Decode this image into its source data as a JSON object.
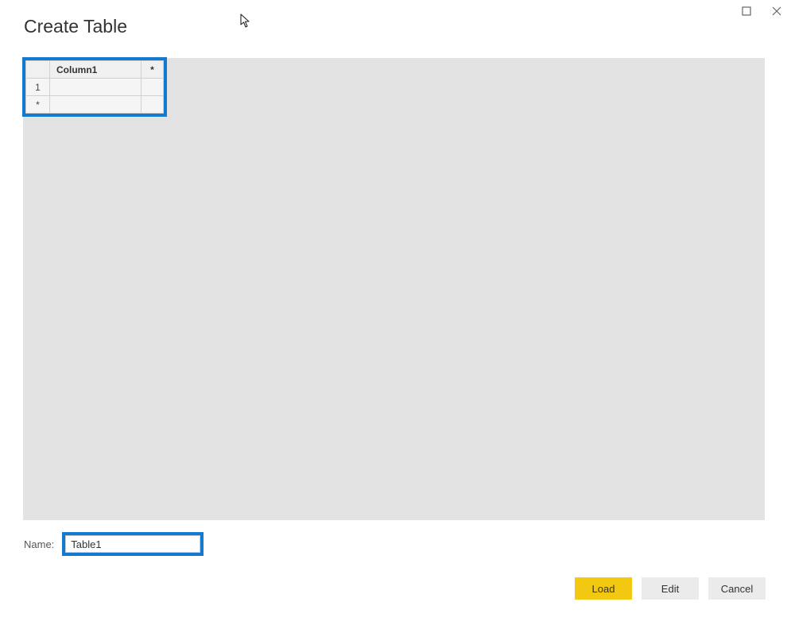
{
  "dialog": {
    "title": "Create Table"
  },
  "table": {
    "columnHeader": "Column1",
    "addColumnMarker": "*",
    "rows": [
      {
        "num": "1",
        "value": ""
      },
      {
        "num": "*",
        "value": ""
      }
    ]
  },
  "nameField": {
    "label": "Name:",
    "value": "Table1"
  },
  "buttons": {
    "load": "Load",
    "edit": "Edit",
    "cancel": "Cancel"
  }
}
